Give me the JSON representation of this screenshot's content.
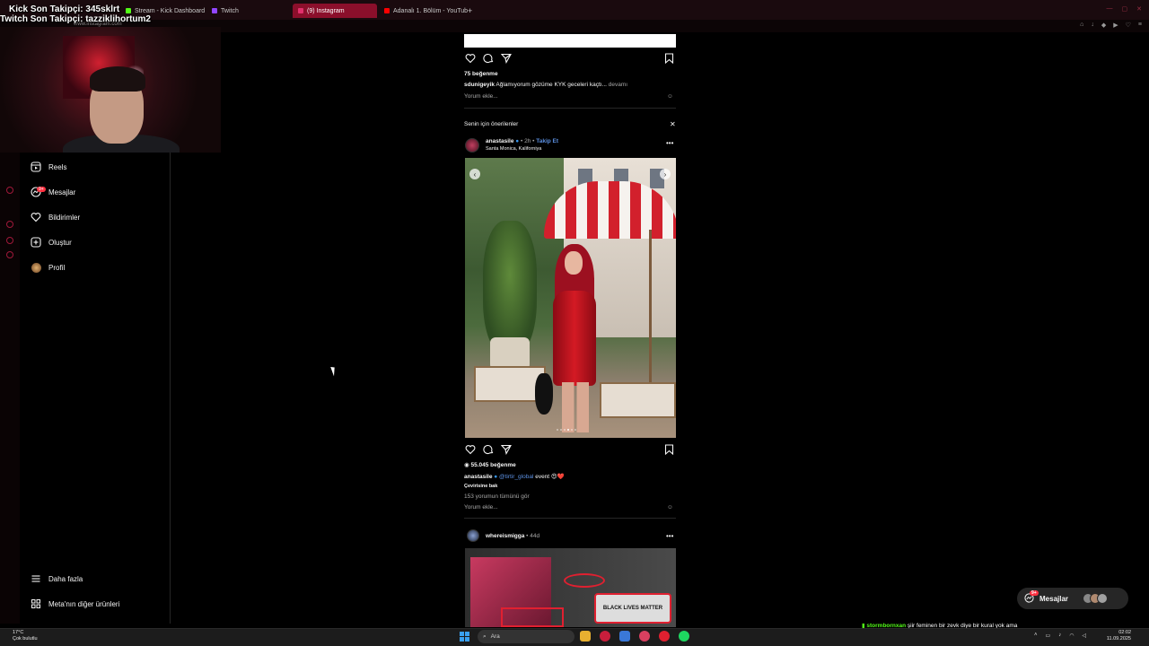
{
  "overlay": {
    "kick_follower": "Kick Son Takipçi: 345sklrt",
    "twitch_follower": "Twitch Son Takipçi: tazziklihortum2"
  },
  "browser": {
    "tabs": [
      {
        "label": "Stream - Kick Dashboard",
        "color": "#53fc18"
      },
      {
        "label": "Twitch",
        "color": "#9146ff"
      },
      {
        "label": "(9) Instagram",
        "color": "#e1306c"
      },
      {
        "label": "Adanalı 1. Bölüm - YouTub",
        "color": "#ff0000"
      }
    ],
    "new_tab_icon": "plus-icon",
    "url": "www.instagram.com"
  },
  "sidebar": {
    "items": [
      {
        "label": "Reels",
        "icon": "reels-icon"
      },
      {
        "label": "Mesajlar",
        "icon": "messenger-icon",
        "badge": "9+"
      },
      {
        "label": "Bildirimler",
        "icon": "heart-icon"
      },
      {
        "label": "Oluştur",
        "icon": "plus-square-icon"
      },
      {
        "label": "Profil",
        "icon": "profile-avatar"
      }
    ],
    "bottom": [
      {
        "label": "Daha fazla",
        "icon": "menu-icon"
      },
      {
        "label": "Meta'nın diğer ürünleri",
        "icon": "grid-icon"
      }
    ]
  },
  "feed": {
    "post1": {
      "likes": "75 beğenme",
      "user": "sdunigeyik",
      "caption": "Ağlamıyorum gözüme KYK geceleri kaçtı...",
      "more": "devamı",
      "comment_placeholder": "Yorum ekle..."
    },
    "suggested": {
      "title": "Senin için önerilenler",
      "user": "anastasile",
      "time": "2h",
      "follow": "Takip Et",
      "location": "Santa Monica, Kaliforniya",
      "carousel": {
        "count": 6,
        "active_index": 3
      },
      "likes": "55.045 beğenme",
      "caption_user": "anastasile",
      "mention": "@tirtir_global",
      "caption_text": "event 😍❤️",
      "translate": "Çevirisine bak",
      "comments": "153 yorumun tümünü gör",
      "comment_placeholder": "Yorum ekle..."
    },
    "post3": {
      "user": "whereismigga",
      "time": "44d",
      "image_text": "BLACK LIVES MATTER"
    }
  },
  "messages_pill": {
    "label": "Mesajlar",
    "badge": "9+"
  },
  "chat": {
    "user": "stormbornxan",
    "text": "şiir feminen bir zevk diye bir kural yok ama"
  },
  "taskbar": {
    "weather_temp": "17°C",
    "weather_desc": "Çok bulutlu",
    "search_placeholder": "Ara",
    "time": "02:02",
    "date": "11.09.2025"
  },
  "colors": {
    "accent_red": "#ff3040",
    "link_blue": "#5b8fe0",
    "kick_green": "#53fc18"
  }
}
